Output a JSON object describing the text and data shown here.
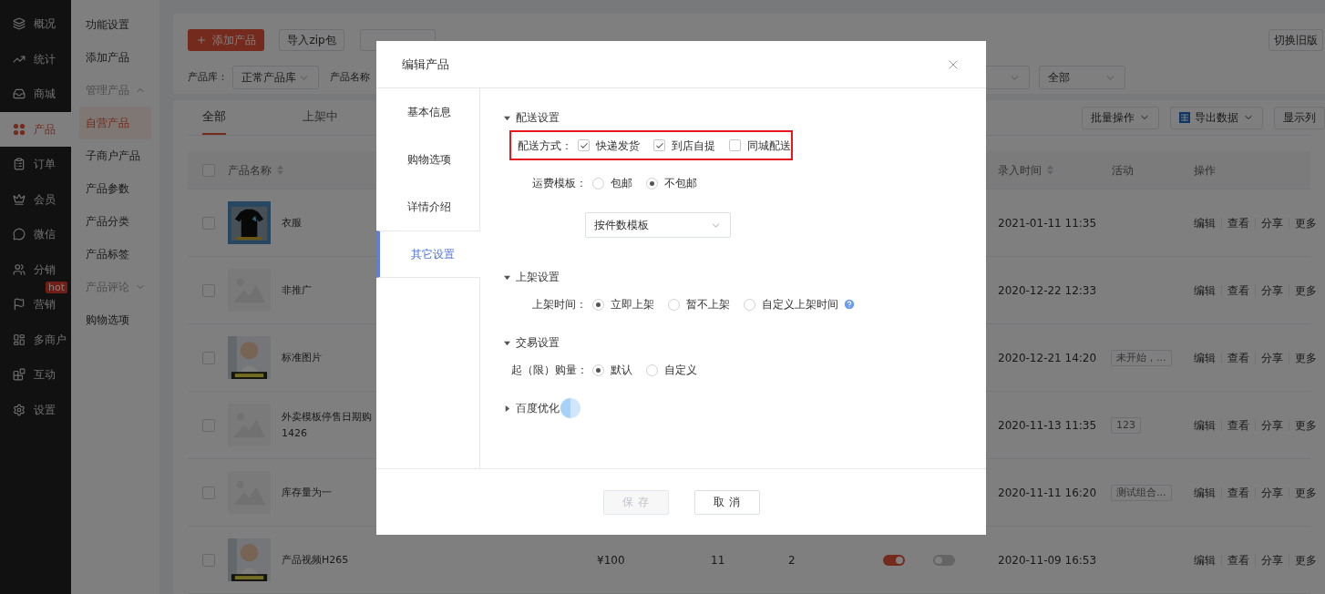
{
  "sidebar": {
    "items": [
      {
        "label": "概况",
        "selected": false
      },
      {
        "label": "统计",
        "selected": false
      },
      {
        "label": "商城",
        "selected": false
      },
      {
        "label": "产品",
        "selected": true
      },
      {
        "label": "订单",
        "selected": false
      },
      {
        "label": "会员",
        "selected": false
      },
      {
        "label": "微信",
        "selected": false
      },
      {
        "label": "分销",
        "selected": false
      },
      {
        "label": "营销",
        "selected": false,
        "badge": "hot"
      },
      {
        "label": "多商户",
        "selected": false
      },
      {
        "label": "互动",
        "selected": false
      },
      {
        "label": "设置",
        "selected": false
      }
    ]
  },
  "submenu": {
    "items": [
      {
        "label": "功能设置",
        "kind": "link",
        "selected": false
      },
      {
        "label": "添加产品",
        "kind": "link",
        "selected": false
      },
      {
        "label": "管理产品",
        "kind": "group",
        "expanded": true,
        "selected": false
      },
      {
        "label": "自营产品",
        "kind": "link",
        "selected": true
      },
      {
        "label": "子商户产品",
        "kind": "link",
        "selected": false
      },
      {
        "label": "产品参数",
        "kind": "link",
        "selected": false
      },
      {
        "label": "产品分类",
        "kind": "link",
        "selected": false
      },
      {
        "label": "产品标签",
        "kind": "link",
        "selected": false
      },
      {
        "label": "产品评论",
        "kind": "group",
        "expanded": false,
        "selected": false
      },
      {
        "label": "购物选项",
        "kind": "link",
        "selected": false
      }
    ]
  },
  "toolbar": {
    "add_button": "添加产品",
    "import_zip": "导入zip包",
    "switch_button": "切换旧版"
  },
  "filters": {
    "left": [
      {
        "label": "产品库：",
        "value": "正常产品库"
      },
      {
        "label": "产品名称"
      }
    ],
    "right": [
      {
        "kind": "select"
      },
      {
        "kind": "select",
        "value": "全部"
      }
    ]
  },
  "tabs": [
    {
      "label": "全部",
      "selected": true
    },
    {
      "label": "上架中",
      "selected": false
    }
  ],
  "actions": [
    {
      "label": "批量操作",
      "kind": "dropdown"
    },
    {
      "label": "导出数据",
      "kind": "export"
    },
    {
      "label": "显示列",
      "kind": "plain"
    }
  ],
  "table": {
    "select_all": {
      "checked": false
    },
    "columns": [
      {
        "label": "产品名称",
        "sortable": true
      },
      {
        "label": "录入时间",
        "sortable": true
      },
      {
        "label": "活动",
        "sortable": false
      },
      {
        "label": "操作",
        "sortable": false
      }
    ],
    "rows": [
      {
        "checked": false,
        "kind": "picture",
        "name": "衣服",
        "time": "2021-01-11 11:35",
        "actions": [
          "编辑",
          "查看",
          "分享",
          "更多"
        ]
      },
      {
        "checked": false,
        "kind": "placeholder",
        "name": "非推广",
        "time": "2020-12-22 12:33",
        "actions": [
          "编辑",
          "查看",
          "分享",
          "更多"
        ]
      },
      {
        "checked": false,
        "kind": "picture",
        "name": "标准图片",
        "time": "2020-12-21 14:20",
        "tag": "未开始，...",
        "actions": [
          "编辑",
          "查看",
          "分享",
          "更多"
        ]
      },
      {
        "checked": false,
        "kind": "placeholder",
        "name": "外卖模板停售日期购",
        "name_line2": "1426",
        "time": "2020-11-13 11:35",
        "tag": "123",
        "actions": [
          "编辑",
          "查看",
          "分享",
          "更多"
        ]
      },
      {
        "checked": false,
        "kind": "placeholder",
        "name": "库存量为一",
        "time": "2020-11-11 16:20",
        "tag": "测试组合...",
        "actions": [
          "编辑",
          "查看",
          "分享",
          "更多"
        ]
      },
      {
        "checked": false,
        "kind": "picture",
        "name": "产品视频H265",
        "price": "¥100",
        "column_4": "11",
        "column_5": "2",
        "switch_1": {
          "on": true
        },
        "switch_2": {
          "on": false
        },
        "time": "2020-11-09 16:53",
        "actions": [
          "编辑",
          "查看",
          "分享",
          "更多"
        ]
      }
    ]
  },
  "modal": {
    "title": "编辑产品",
    "nav": [
      {
        "label": "基本信息",
        "selected": false
      },
      {
        "label": "购物选项",
        "selected": false
      },
      {
        "label": "详情介绍",
        "selected": false
      },
      {
        "label": "其它设置",
        "selected": true
      }
    ],
    "sections": [
      {
        "title": "配送设置",
        "expanded": true,
        "rows": [
          {
            "kind": "checkbox",
            "label": "配送方式：",
            "highlighted": true,
            "options": [
              {
                "label": "快递发货",
                "checked": true
              },
              {
                "label": "到店自提",
                "checked": true
              },
              {
                "label": "同城配送",
                "checked": false
              }
            ]
          },
          {
            "kind": "radio",
            "label": "运费模板：",
            "options": [
              {
                "label": "包邮",
                "selected": false
              },
              {
                "label": "不包邮",
                "selected": true
              }
            ]
          },
          {
            "kind": "select",
            "value": "按件数模板"
          }
        ]
      },
      {
        "title": "上架设置",
        "expanded": true,
        "rows": [
          {
            "kind": "radio",
            "label": "上架时间：",
            "help": true,
            "options": [
              {
                "label": "立即上架",
                "selected": true
              },
              {
                "label": "暂不上架",
                "selected": false
              },
              {
                "label": "自定义上架时间",
                "selected": false
              }
            ]
          }
        ]
      },
      {
        "title": "交易设置",
        "expanded": true,
        "rows": [
          {
            "kind": "radio",
            "label": "起（限）购量：",
            "options": [
              {
                "label": "默认",
                "selected": true
              },
              {
                "label": "自定义",
                "selected": false
              }
            ]
          }
        ]
      },
      {
        "title": "百度优化",
        "expanded": false
      }
    ],
    "save": {
      "label": "保存",
      "disabled": true
    },
    "cancel": "取消"
  }
}
